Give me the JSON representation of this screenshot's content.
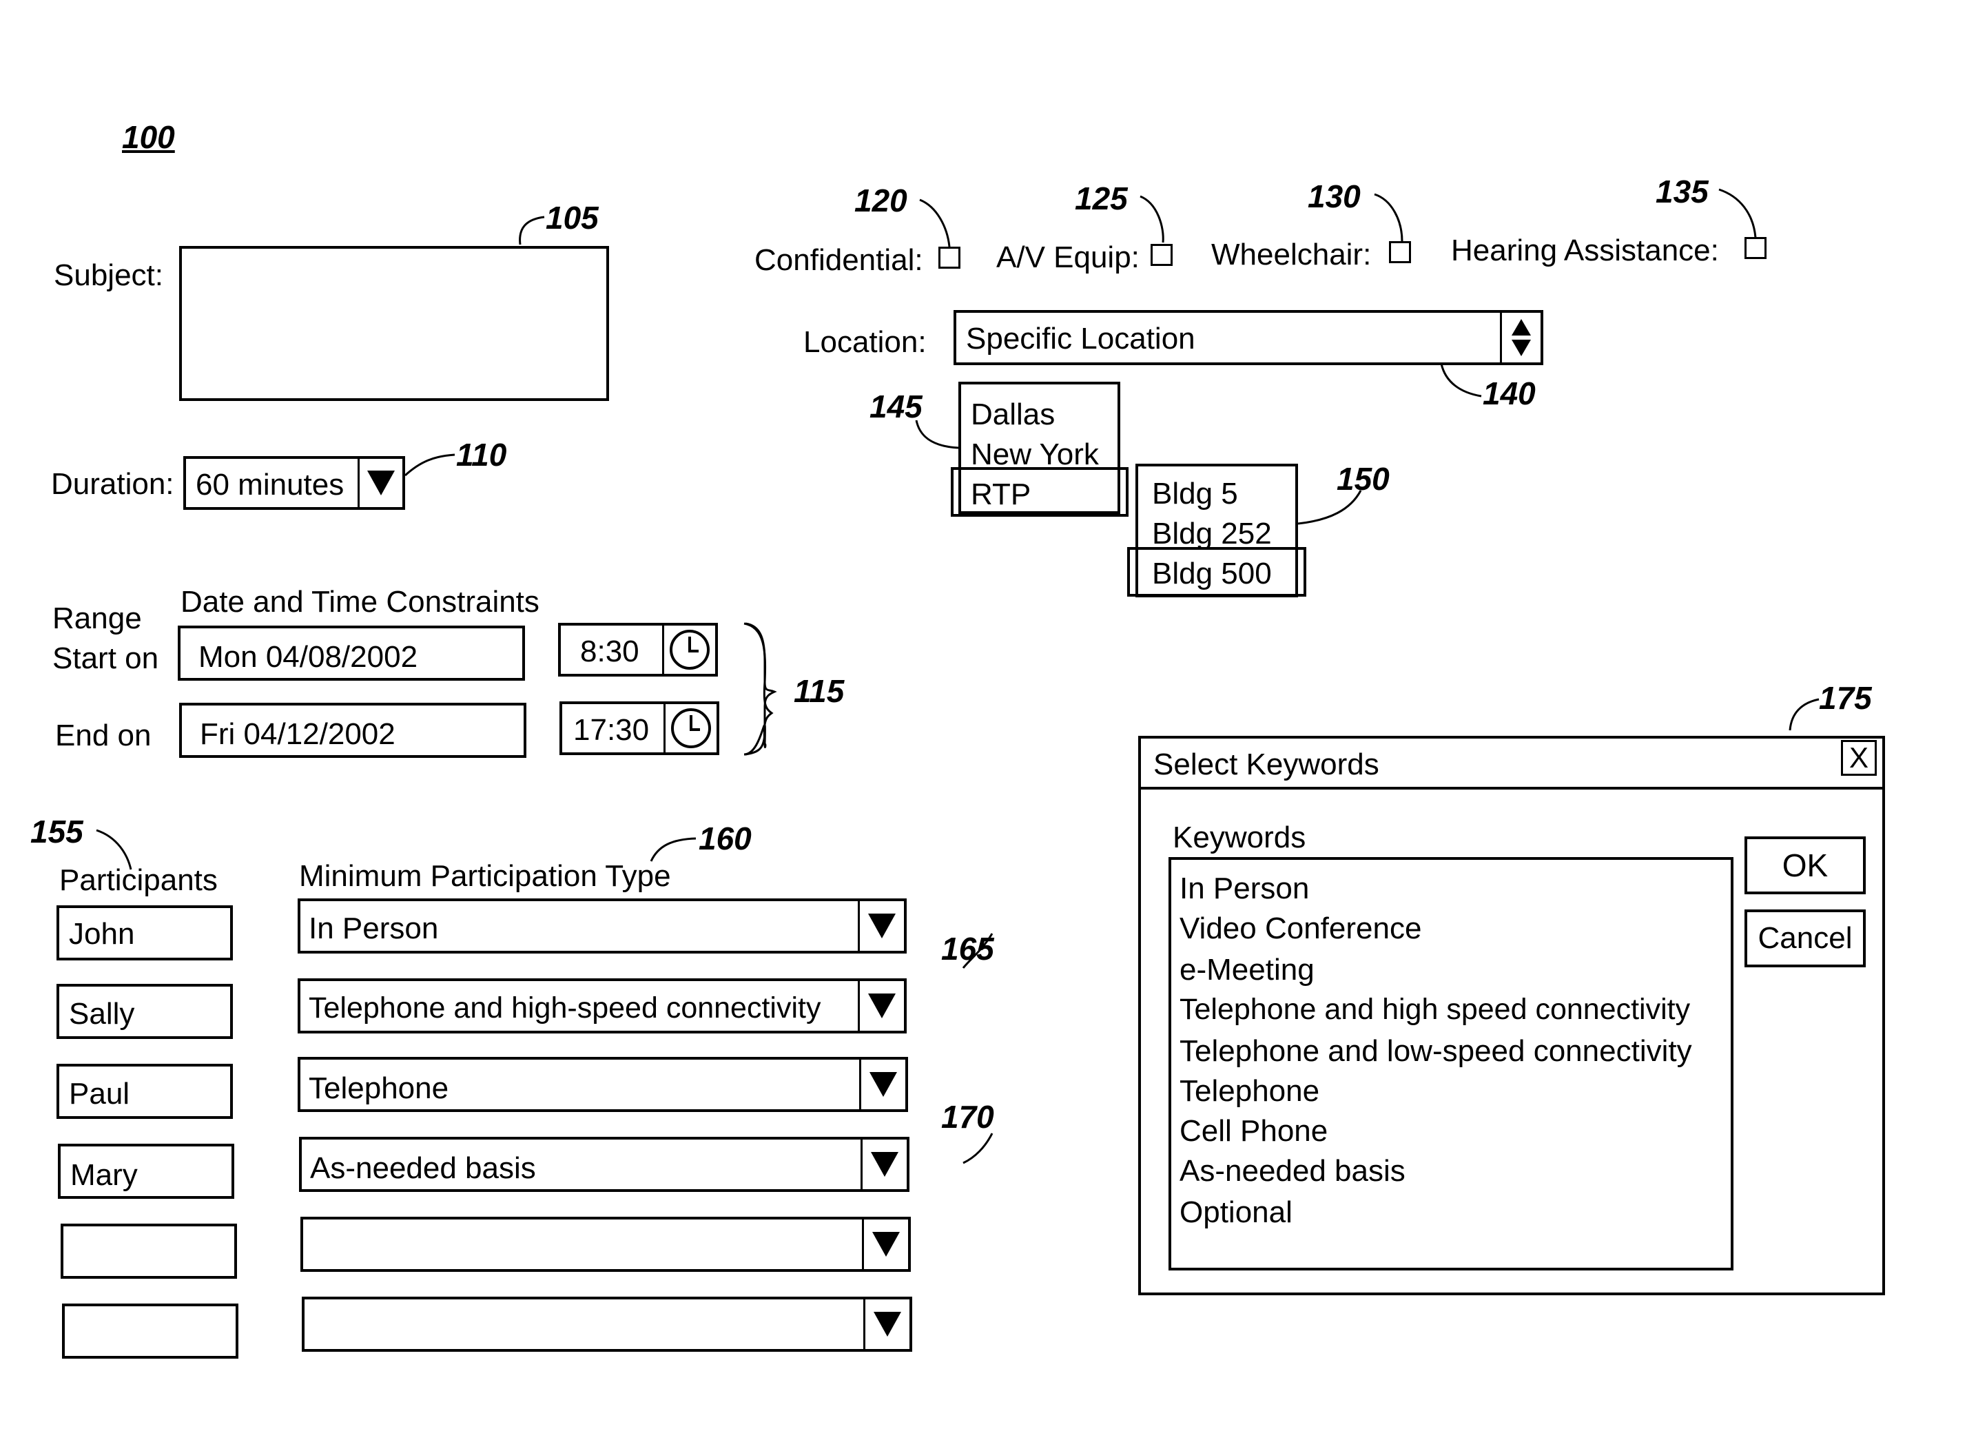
{
  "figure_ref": "100",
  "refs": {
    "subject": "105",
    "duration": "110",
    "date_time": "115",
    "confidential": "120",
    "av_equip": "125",
    "wheelchair": "130",
    "hearing": "135",
    "location": "140",
    "cities": "145",
    "buildings": "150",
    "participants": "155",
    "participation_type": "160",
    "participation_dropdown": "165",
    "participation_dropdown_2": "170",
    "keywords_dialog": "175"
  },
  "subject": {
    "label": "Subject:",
    "value": ""
  },
  "duration": {
    "label": "Duration:",
    "value": "60 minutes"
  },
  "checkboxes": [
    {
      "label": "Confidential:",
      "checked": false
    },
    {
      "label": "A/V Equip:",
      "checked": false
    },
    {
      "label": "Wheelchair:",
      "checked": false
    },
    {
      "label": "Hearing Assistance:",
      "checked": false
    }
  ],
  "location": {
    "label": "Location:",
    "value": "Specific Location",
    "cities": [
      "Dallas",
      "New York",
      "RTP"
    ],
    "selected_city": "RTP",
    "buildings": [
      "Bldg 5",
      "Bldg 252",
      "Bldg 500"
    ],
    "selected_building": "Bldg 500"
  },
  "date_time": {
    "header": "Date and Time Constraints",
    "range_label": "Range",
    "start_label": "Start on",
    "start_date": "Mon 04/08/2002",
    "start_time": "8:30",
    "end_label": "End on",
    "end_date": "Fri 04/12/2002",
    "end_time": "17:30"
  },
  "participants": {
    "header": "Participants",
    "type_header": "Minimum Participation Type",
    "rows": [
      {
        "name": "John",
        "type": "In Person"
      },
      {
        "name": "Sally",
        "type": "Telephone and high-speed connectivity"
      },
      {
        "name": "Paul",
        "type": "Telephone"
      },
      {
        "name": "Mary",
        "type": "As-needed basis"
      },
      {
        "name": "",
        "type": ""
      },
      {
        "name": "",
        "type": ""
      }
    ]
  },
  "keywords_dialog": {
    "title": "Select Keywords",
    "close_label": "X",
    "list_label": "Keywords",
    "items": [
      "In Person",
      "Video Conference",
      "e-Meeting",
      "Telephone and high speed connectivity",
      "Telephone and low-speed connectivity",
      "Telephone",
      "Cell Phone",
      "As-needed basis",
      "Optional"
    ],
    "ok_label": "OK",
    "cancel_label": "Cancel"
  }
}
